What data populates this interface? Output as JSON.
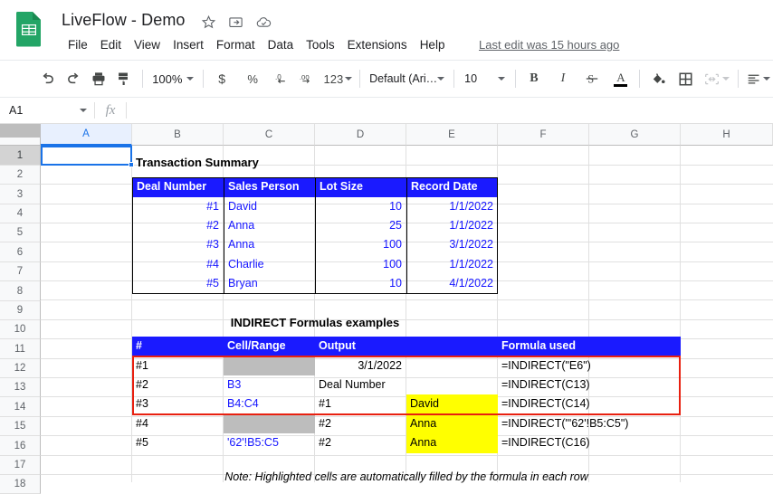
{
  "app": {
    "doc_title": "LiveFlow - Demo",
    "title_icons": [
      "star-icon",
      "move-to-folder-icon",
      "cloud-saved-icon"
    ],
    "menus": [
      "File",
      "Edit",
      "View",
      "Insert",
      "Format",
      "Data",
      "Tools",
      "Extensions",
      "Help"
    ],
    "last_edit": "Last edit was 15 hours ago"
  },
  "toolbar": {
    "undo": "undo-icon",
    "redo": "redo-icon",
    "print": "print-icon",
    "paint_format": "paint-format-icon",
    "zoom": "100%",
    "currency": "$",
    "percent": "%",
    "decrease_decimal": ".0",
    "increase_decimal": ".00",
    "more_formats": "123",
    "font": "Default (Ari…",
    "font_size": "10",
    "bold": "B",
    "italic": "I",
    "strikethrough": "S",
    "text_color": "A",
    "fill_color": "fill-color-icon",
    "borders": "borders-icon",
    "merge_cells": "merge-cells-icon",
    "horizontal_align": "horizontal-align-icon"
  },
  "formula_bar": {
    "name_box": "A1",
    "fx_label": "fx",
    "formula_value": "",
    "formula_placeholder": ""
  },
  "grid": {
    "columns": [
      "A",
      "B",
      "C",
      "D",
      "E",
      "F",
      "G",
      "H"
    ],
    "selected_column": "A",
    "rows": [
      "1",
      "2",
      "3",
      "4",
      "5",
      "6",
      "7",
      "8",
      "9",
      "10",
      "11",
      "12",
      "13",
      "14",
      "15",
      "16",
      "17",
      "18"
    ],
    "selected_row": "1",
    "selected_cell": "A1"
  },
  "transaction_summary": {
    "title": "Transaction Summary",
    "headers": [
      "Deal Number",
      "Sales Person",
      "Lot Size",
      "Record Date"
    ],
    "rows": [
      {
        "deal": "#1",
        "person": "David",
        "lot": "10",
        "date": "1/1/2022"
      },
      {
        "deal": "#2",
        "person": "Anna",
        "lot": "25",
        "date": "1/1/2022"
      },
      {
        "deal": "#3",
        "person": "Anna",
        "lot": "100",
        "date": "3/1/2022"
      },
      {
        "deal": "#4",
        "person": "Charlie",
        "lot": "100",
        "date": "1/1/2022"
      },
      {
        "deal": "#5",
        "person": "Bryan",
        "lot": "10",
        "date": "4/1/2022"
      }
    ]
  },
  "indirect_examples": {
    "title": "INDIRECT Formulas examples",
    "headers": [
      "#",
      "Cell/Range",
      "Output",
      "",
      "Formula used"
    ],
    "rows": [
      {
        "num": "#1",
        "range": "",
        "output": "3/1/2022",
        "extra": "",
        "formula": "=INDIRECT(\"E6\")"
      },
      {
        "num": "#2",
        "range": "B3",
        "output": "Deal Number",
        "extra": "",
        "formula": "=INDIRECT(C13)"
      },
      {
        "num": "#3",
        "range": "B4:C4",
        "output": "#1",
        "extra": "David",
        "formula": "=INDIRECT(C14)"
      },
      {
        "num": "#4",
        "range": "",
        "output": "#2",
        "extra": "Anna",
        "formula": "=INDIRECT(\"'62'!B5:C5\")"
      },
      {
        "num": "#5",
        "range": "'62'!B5:C5",
        "output": "#2",
        "extra": "Anna",
        "formula": "=INDIRECT(C16)"
      }
    ],
    "note": "Note: Highlighted cells are automatically filled by the formula in each row"
  },
  "colors": {
    "header_blue": "#1a1aff",
    "text_blue": "#1414ff",
    "highlight_yellow": "#ffff00",
    "gray_fill": "#bdbdbd",
    "red_outline": "#e82010",
    "sheets_green": "#23a566",
    "accent_blue": "#1a73e8"
  }
}
